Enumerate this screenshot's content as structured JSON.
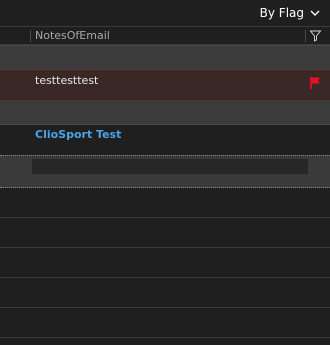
{
  "sort": {
    "label": "By Flag"
  },
  "header": {
    "column_title": "NotesOfEmail"
  },
  "rows": [
    {
      "note": "testtesttest",
      "flagged": true
    },
    {
      "link": "ClioSport Test"
    }
  ],
  "colors": {
    "flag": "#e81123",
    "link": "#4aa3e8",
    "flagged_row_bg": "#3a2827"
  },
  "icons": {
    "sort": "chevron-down-icon",
    "filter": "filter-icon",
    "flag": "flag-icon"
  }
}
